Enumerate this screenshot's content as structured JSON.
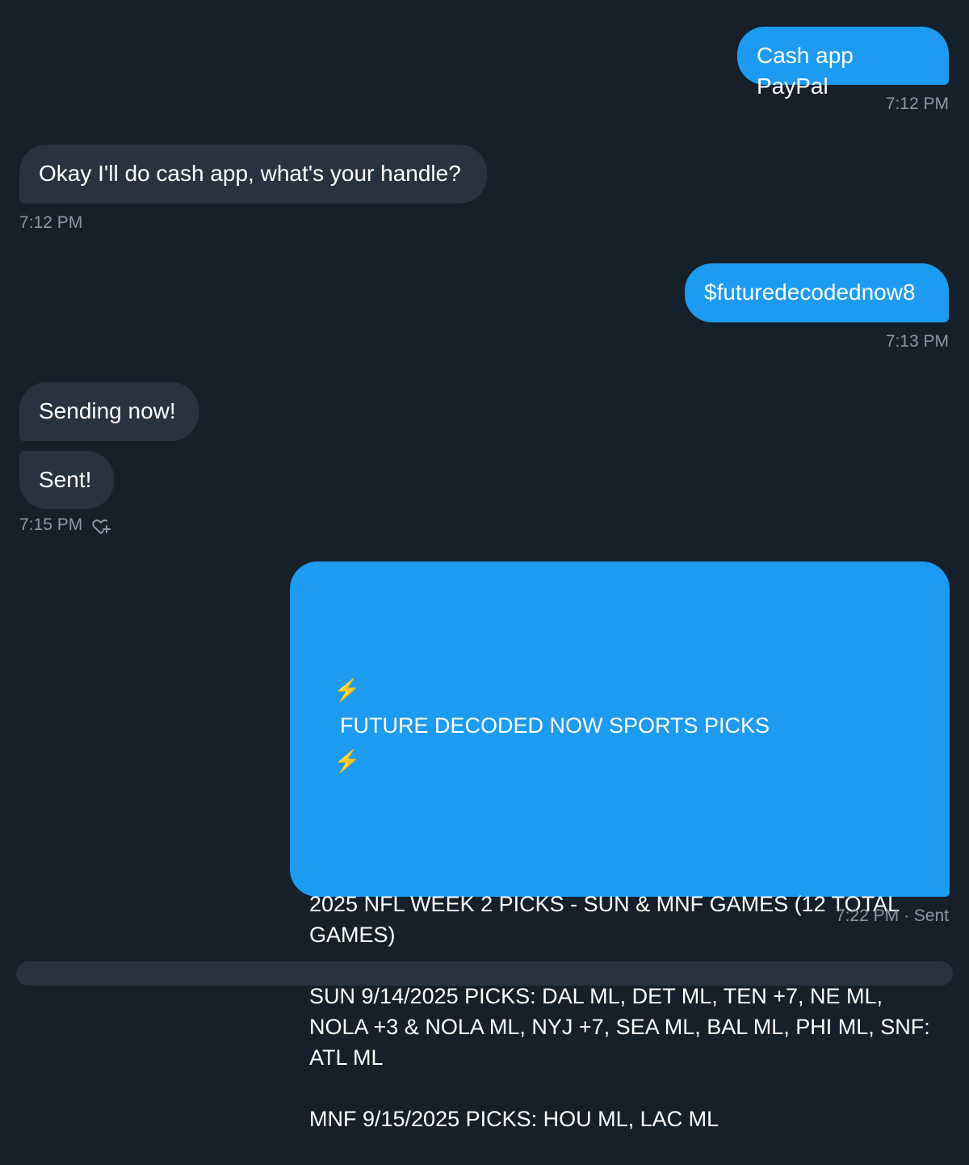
{
  "messages": [
    {
      "side": "out",
      "text": "Cash app PayPal"
    },
    {
      "side": "in",
      "text": "Okay I'll do cash app, what's your handle?"
    },
    {
      "side": "out",
      "text": "$futuredecodednow8"
    },
    {
      "side": "in",
      "text": "Sending now!"
    },
    {
      "side": "in",
      "text": "Sent!"
    },
    {
      "side": "out",
      "text": "2025 NFL WEEK 2 PICKS - SUN & MNF GAMES (12 TOTAL GAMES)\n\nSUN 9/14/2025 PICKS: DAL ML, DET ML, TEN +7, NE ML, NOLA +3 & NOLA ML, NYJ +7, SEA ML, BAL ML, PHI ML, SNF: ATL ML\n\nMNF 9/15/2025 PICKS: HOU ML, LAC ML"
    }
  ],
  "picks_header": "FUTURE DECODED NOW SPORTS PICKS",
  "bolt_glyph": "⚡",
  "timestamps": {
    "t1": "7:12 PM",
    "t2": "7:12 PM",
    "t3": "7:13 PM",
    "t4": "7:15 PM",
    "t5": "7:22 PM · Sent"
  },
  "icons": {
    "react": "heart-plus-icon"
  },
  "colors": {
    "background": "#15202b",
    "outgoing_bubble": "#1d9bf0",
    "incoming_bubble": "#273340",
    "timestamp": "#8b98a5",
    "bolt": "#ffd23f"
  }
}
